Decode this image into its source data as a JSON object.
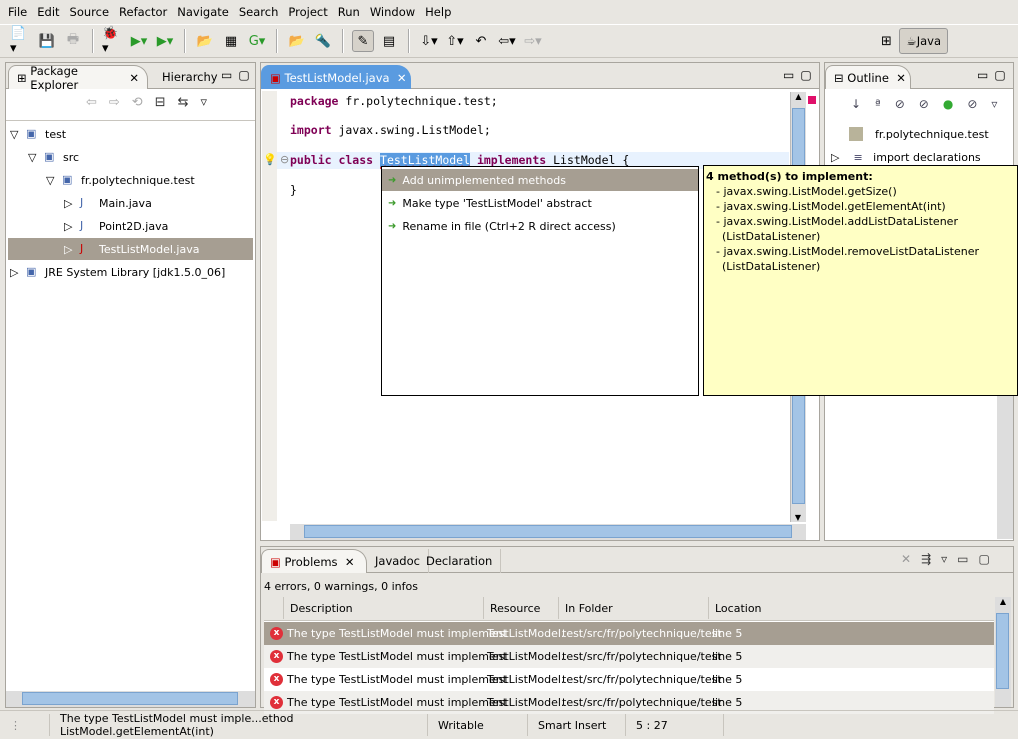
{
  "menu": [
    "File",
    "Edit",
    "Source",
    "Refactor",
    "Navigate",
    "Search",
    "Project",
    "Run",
    "Window",
    "Help"
  ],
  "perspective": {
    "label": "Java"
  },
  "package_explorer": {
    "tabs": [
      "Package Explorer",
      "Hierarchy"
    ],
    "tree": [
      {
        "label": "test",
        "level": 0,
        "expanded": true
      },
      {
        "label": "src",
        "level": 1,
        "expanded": true
      },
      {
        "label": "fr.polytechnique.test",
        "level": 2,
        "expanded": true
      },
      {
        "label": "Main.java",
        "level": 3
      },
      {
        "label": "Point2D.java",
        "level": 3
      },
      {
        "label": "TestListModel.java",
        "level": 3,
        "selected": true,
        "error": true
      },
      {
        "label": "JRE System Library [jdk1.5.0_06]",
        "level": 0
      }
    ]
  },
  "editor": {
    "tab": "TestListModel.java",
    "lines": {
      "l1a": "package",
      "l1b": " fr.polytechnique.test;",
      "l2a": "import",
      "l2b": " javax.swing.ListModel;",
      "l3a": "public class ",
      "l3b": "TestListModel",
      "l3c": " implements",
      "l3d": " ListModel {",
      "l4": "}"
    }
  },
  "quick_fix": {
    "items": [
      "Add unimplemented methods",
      "Make type 'TestListModel' abstract",
      "Rename in file (Ctrl+2 R direct access)"
    ]
  },
  "tooltip": {
    "title": "4 method(s) to implement:",
    "lines": [
      "- javax.swing.ListModel.getSize()",
      "- javax.swing.ListModel.getElementAt(int)",
      "- javax.swing.ListModel.addListDataListener",
      "(ListDataListener)",
      "- javax.swing.ListModel.removeListDataListener",
      "(ListDataListener)"
    ]
  },
  "outline": {
    "tab": "Outline",
    "items": [
      "fr.polytechnique.test",
      "import declarations"
    ]
  },
  "problems": {
    "tabs": [
      "Problems",
      "Javadoc",
      "Declaration"
    ],
    "summary": "4 errors, 0 warnings, 0 infos",
    "columns": [
      "Description",
      "Resource",
      "In Folder",
      "Location"
    ],
    "rows": [
      [
        "The type TestListModel must implement",
        "TestListModel.",
        "test/src/fr/polytechnique/test",
        "line 5"
      ],
      [
        "The type TestListModel must implement",
        "TestListModel.",
        "test/src/fr/polytechnique/test",
        "line 5"
      ],
      [
        "The type TestListModel must implement",
        "TestListModel.",
        "test/src/fr/polytechnique/test",
        "line 5"
      ],
      [
        "The type TestListModel must implement",
        "TestListModel.",
        "test/src/fr/polytechnique/test",
        "line 5"
      ]
    ]
  },
  "status": {
    "message": "The type TestListModel must imple...ethod ListModel.getElementAt(int)",
    "writable": "Writable",
    "insert": "Smart Insert",
    "position": "5 : 27"
  },
  "colors": {
    "selection": "#a69e92",
    "tab_active": "#5a9be0",
    "tooltip": "#ffffc4",
    "error": "#e0303a"
  }
}
